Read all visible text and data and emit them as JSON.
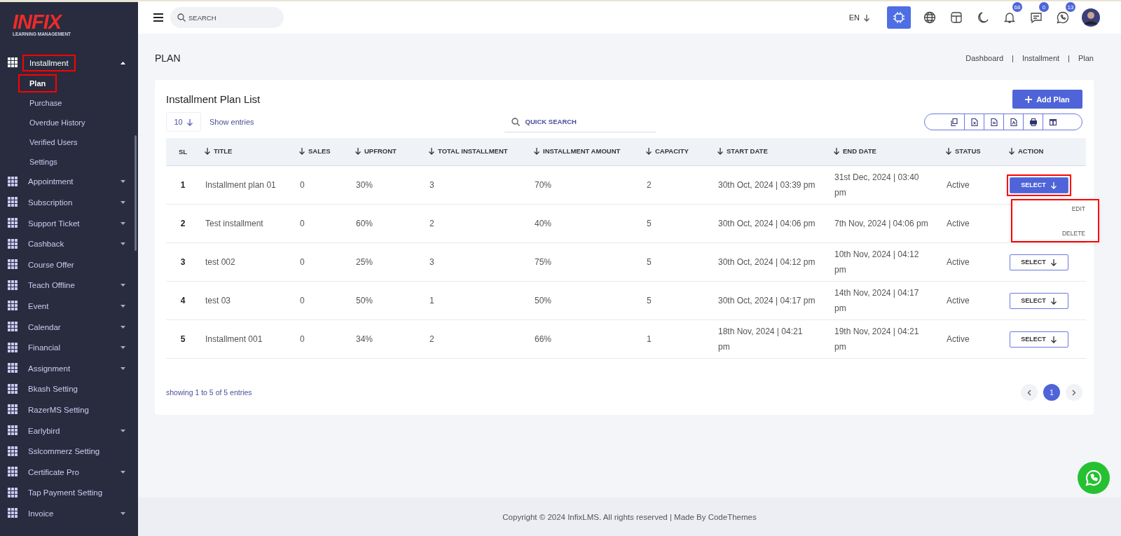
{
  "logo": {
    "name": "INFIX",
    "tagline": "LEARNING MANAGEMENT"
  },
  "sidebar": {
    "items": [
      {
        "label": "Installment",
        "kind": "group",
        "expanded": true,
        "annotated": true,
        "children": [
          {
            "label": "Plan",
            "selected": true,
            "annotated": true
          },
          {
            "label": "Purchase",
            "selected": false,
            "annotated": false
          },
          {
            "label": "Overdue History",
            "selected": false,
            "annotated": false
          },
          {
            "label": "Verified Users",
            "selected": false,
            "annotated": false
          },
          {
            "label": "Settings",
            "selected": false,
            "annotated": false
          }
        ]
      },
      {
        "label": "Appointment",
        "kind": "group",
        "expanded": false,
        "annotated": false
      },
      {
        "label": "Subscription",
        "kind": "group",
        "expanded": false,
        "annotated": false
      },
      {
        "label": "Support Ticket",
        "kind": "group",
        "expanded": false,
        "annotated": false
      },
      {
        "label": "Cashback",
        "kind": "group",
        "expanded": false,
        "annotated": false
      },
      {
        "label": "Course Offer",
        "kind": "link",
        "annotated": false
      },
      {
        "label": "Teach Offline",
        "kind": "group",
        "expanded": false,
        "annotated": false
      },
      {
        "label": "Event",
        "kind": "group",
        "expanded": false,
        "annotated": false
      },
      {
        "label": "Calendar",
        "kind": "group",
        "expanded": false,
        "annotated": false
      },
      {
        "label": "Financial",
        "kind": "group",
        "expanded": false,
        "annotated": false
      },
      {
        "label": "Assignment",
        "kind": "group",
        "expanded": false,
        "annotated": false
      },
      {
        "label": "Bkash Setting",
        "kind": "link",
        "annotated": false
      },
      {
        "label": "RazerMS Setting",
        "kind": "link",
        "annotated": false
      },
      {
        "label": "Earlybird",
        "kind": "group",
        "expanded": false,
        "annotated": false
      },
      {
        "label": "Sslcommerz Setting",
        "kind": "link",
        "annotated": false
      },
      {
        "label": "Certificate Pro",
        "kind": "group",
        "expanded": false,
        "annotated": false
      },
      {
        "label": "Tap Payment Setting",
        "kind": "link",
        "annotated": false
      },
      {
        "label": "Invoice",
        "kind": "group",
        "expanded": false,
        "annotated": false
      }
    ]
  },
  "topbar": {
    "search": {
      "placeholder": "SEARCH"
    },
    "language": "EN",
    "icons": [
      {
        "kind": "ai"
      },
      {
        "kind": "globe"
      },
      {
        "kind": "layout"
      },
      {
        "kind": "moon"
      },
      {
        "kind": "bell",
        "badge": "68"
      },
      {
        "kind": "chat",
        "badge": "0"
      },
      {
        "kind": "whatsapp",
        "badge": "13"
      },
      {
        "kind": "avatar"
      }
    ]
  },
  "page": {
    "title": "PLAN",
    "breadcrumb": [
      "Dashboard",
      "Installment",
      "Plan"
    ],
    "breadcrumb_separator": "|"
  },
  "card": {
    "title": "Installment Plan List",
    "add_button": "Add Plan",
    "page_size": "10",
    "show_entries": "Show entries",
    "quick_search": {
      "placeholder": "QUICK SEARCH"
    },
    "export_buttons": [
      {
        "kind": "copy"
      },
      {
        "kind": "excel"
      },
      {
        "kind": "csv"
      },
      {
        "kind": "pdf"
      },
      {
        "kind": "print"
      },
      {
        "kind": "columns"
      }
    ]
  },
  "table": {
    "columns": [
      {
        "label": "SL",
        "sortable": false
      },
      {
        "label": "TITLE",
        "sortable": true
      },
      {
        "label": "SALES",
        "sortable": true
      },
      {
        "label": "UPFRONT",
        "sortable": true
      },
      {
        "label": "TOTAL INSTALLMENT",
        "sortable": true
      },
      {
        "label": "INSTALLMENT AMOUNT",
        "sortable": true
      },
      {
        "label": "CAPACITY",
        "sortable": true
      },
      {
        "label": "START DATE",
        "sortable": true
      },
      {
        "label": "END DATE",
        "sortable": true
      },
      {
        "label": "STATUS",
        "sortable": true
      },
      {
        "label": "ACTION",
        "sortable": true
      }
    ],
    "rows": [
      {
        "sl": "1",
        "title": "Installment plan 01",
        "sales": "0",
        "upfront": "30%",
        "total_installment": "3",
        "installment_amount": "70%",
        "capacity": "2",
        "start_date": "30th Oct, 2024 | 03:39 pm",
        "end_date": "31st Dec, 2024 | 03:40 pm",
        "status": "Active",
        "action": {
          "label": "SELECT",
          "open": true,
          "annotated": true,
          "menu": [
            "EDIT",
            "DELETE"
          ]
        }
      },
      {
        "sl": "2",
        "title": "Test installment",
        "sales": "0",
        "upfront": "60%",
        "total_installment": "2",
        "installment_amount": "40%",
        "capacity": "5",
        "start_date": "30th Oct, 2024 | 04:06 pm",
        "end_date": "7th Nov, 2024 | 04:06 pm",
        "status": "Active"
      },
      {
        "sl": "3",
        "title": "test 002",
        "sales": "0",
        "upfront": "25%",
        "total_installment": "3",
        "installment_amount": "75%",
        "capacity": "5",
        "start_date": "30th Oct, 2024 | 04:12 pm",
        "end_date": "10th Nov, 2024 | 04:12 pm",
        "status": "Active",
        "action": {
          "label": "SELECT",
          "open": false
        }
      },
      {
        "sl": "4",
        "title": "test 03",
        "sales": "0",
        "upfront": "50%",
        "total_installment": "1",
        "installment_amount": "50%",
        "capacity": "5",
        "start_date": "30th Oct, 2024 | 04:17 pm",
        "end_date": "14th Nov, 2024 | 04:17 pm",
        "status": "Active",
        "action": {
          "label": "SELECT",
          "open": false
        }
      },
      {
        "sl": "5",
        "title": "Installment 001",
        "sales": "0",
        "upfront": "34%",
        "total_installment": "2",
        "installment_amount": "66%",
        "capacity": "1",
        "start_date": "18th Nov, 2024 | 04:21 pm",
        "end_date": "19th Nov, 2024 | 04:21 pm",
        "status": "Active",
        "action": {
          "label": "SELECT",
          "open": false
        }
      }
    ]
  },
  "pagination": {
    "info": "showing 1 to 5 of 5 entries",
    "pages": [
      {
        "label": "1",
        "selected": true
      }
    ]
  },
  "footer": "Copyright © 2024 InfixLMS. All rights reserved | Made By CodeThemes"
}
